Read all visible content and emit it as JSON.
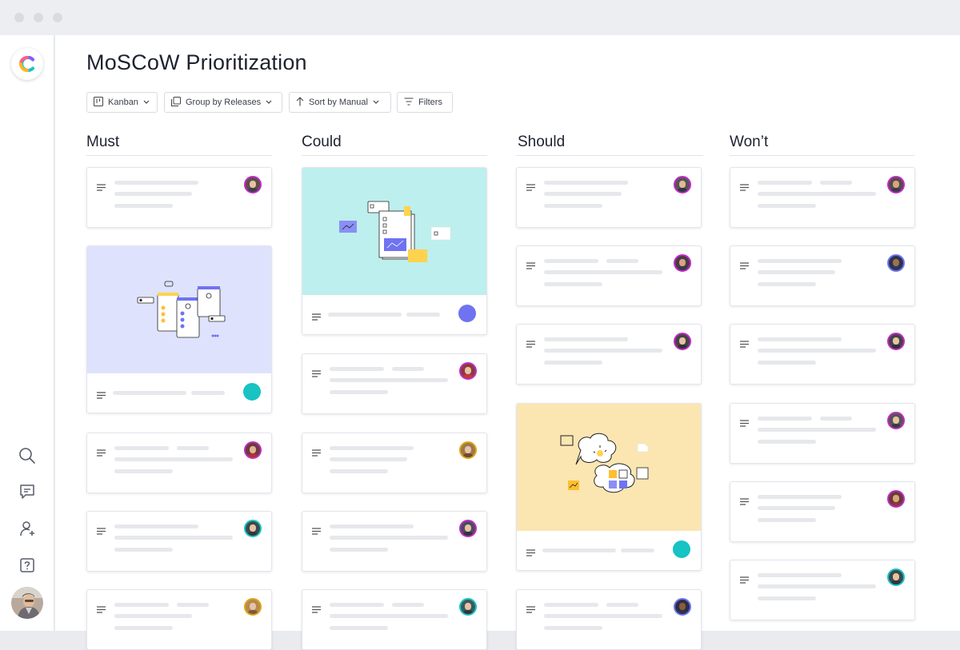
{
  "page": {
    "title": "MoSCoW Prioritization"
  },
  "toolbar": {
    "view_label": "Kanban",
    "group_label": "Group by Releases",
    "sort_label": "Sort by Manual",
    "filters_label": "Filters"
  },
  "columns": [
    {
      "label": "Must"
    },
    {
      "label": "Could"
    },
    {
      "label": "Should"
    },
    {
      "label": "Won’t"
    }
  ],
  "icons": {
    "logo": "app-logo-icon",
    "search": "search-icon",
    "messages": "message-icon",
    "add_user": "add-user-icon",
    "help": "help-icon",
    "view": "kanban-icon",
    "group": "group-icon",
    "sort": "sort-arrow-icon",
    "filters": "filter-icon",
    "chevron": "chevron-down-icon",
    "card_description": "description-lines-icon"
  },
  "colors": {
    "accent_teal": "#17c3c3",
    "accent_purple": "#6f73f0",
    "avatar_ring": "#c02ac8",
    "avatar_ring_alt": "#e0a313",
    "lavender_cover": "#dfe2fd",
    "mint_cover": "#bdefee",
    "sand_cover": "#fbe6b2"
  }
}
